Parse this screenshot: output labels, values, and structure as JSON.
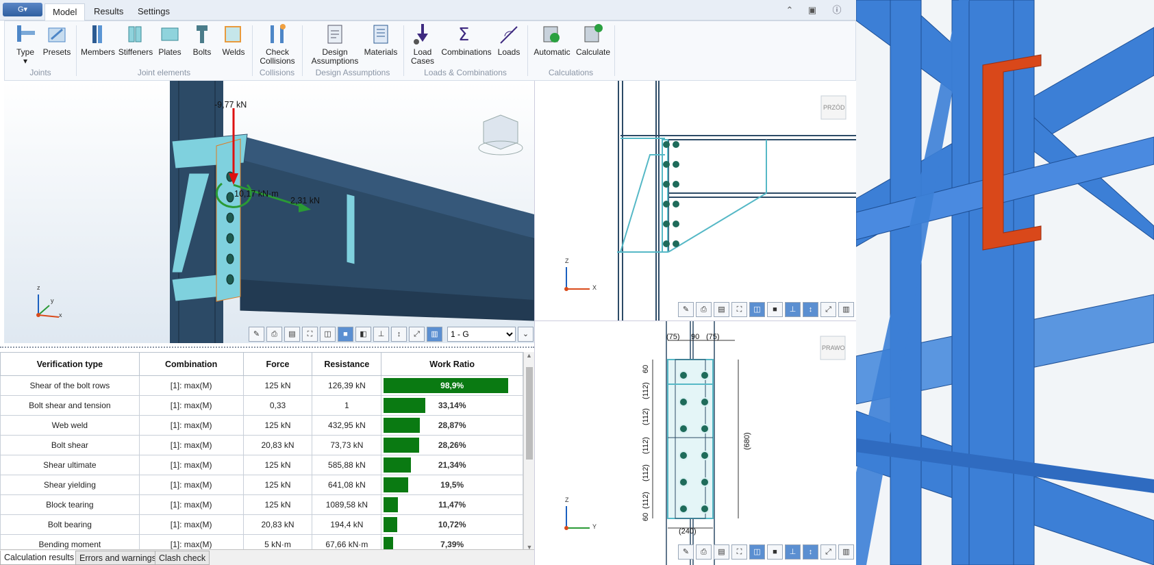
{
  "app_button": "G▾",
  "tabs": [
    {
      "label": "Model"
    },
    {
      "label": "Results"
    },
    {
      "label": "Settings"
    }
  ],
  "ribbon": {
    "buttons": {
      "type": "Type",
      "presets": "Presets",
      "members": "Members",
      "stiffeners": "Stiffeners",
      "plates": "Plates",
      "bolts": "Bolts",
      "welds": "Welds",
      "check1": "Check",
      "check2": "Collisions",
      "design1": "Design",
      "design2": "Assumptions",
      "materials": "Materials",
      "load1": "Load",
      "load2": "Cases",
      "combinations": "Combinations",
      "loads": "Loads",
      "automatic": "Automatic",
      "calculate": "Calculate"
    },
    "groups": {
      "joints": "Joints",
      "joint_elements": "Joint elements",
      "collisions": "Collisions",
      "design_assumptions": "Design Assumptions",
      "loads_combinations": "Loads & Combinations",
      "calculations": "Calculations"
    }
  },
  "view3d": {
    "load_vertical": "-9,77 kN",
    "moment": "10,17 kN·m",
    "load_axial": "2,31 kN",
    "axis_x": "x",
    "axis_y": "y",
    "axis_z": "z",
    "combo_selected": "1 - G"
  },
  "view_front": {
    "cube_label": "PRZÓD",
    "axis_x": "X",
    "axis_z": "Z"
  },
  "view_side": {
    "cube_label": "PRAWO",
    "axis_y": "Y",
    "axis_z": "Z",
    "dims": {
      "top_left": "(75)",
      "top_mid": "90",
      "top_right": "(75)",
      "bottom": "(240)",
      "right": "(680)",
      "v1": "60",
      "v2": "(112)",
      "v3": "(112)",
      "v4": "(112)",
      "v5": "(112)",
      "v6": "(112)",
      "v7": "60"
    }
  },
  "results_table": {
    "headers": [
      "Verification type",
      "Combination",
      "Force",
      "Resistance",
      "Work Ratio"
    ],
    "rows": [
      {
        "type": "Shear of the bolt rows",
        "combination": "[1]: max(M)",
        "force": "125 kN",
        "resistance": "126,39 kN",
        "ratio": "98,9%",
        "value": 98.9
      },
      {
        "type": "Bolt shear and tension",
        "combination": "[1]: max(M)",
        "force": "0,33",
        "resistance": "1",
        "ratio": "33,14%",
        "value": 33.14
      },
      {
        "type": "Web weld",
        "combination": "[1]: max(M)",
        "force": "125 kN",
        "resistance": "432,95 kN",
        "ratio": "28,87%",
        "value": 28.87
      },
      {
        "type": "Bolt shear",
        "combination": "[1]: max(M)",
        "force": "20,83 kN",
        "resistance": "73,73 kN",
        "ratio": "28,26%",
        "value": 28.26
      },
      {
        "type": "Shear ultimate",
        "combination": "[1]: max(M)",
        "force": "125 kN",
        "resistance": "585,88 kN",
        "ratio": "21,34%",
        "value": 21.34
      },
      {
        "type": "Shear yielding",
        "combination": "[1]: max(M)",
        "force": "125 kN",
        "resistance": "641,08 kN",
        "ratio": "19,5%",
        "value": 19.5
      },
      {
        "type": "Block tearing",
        "combination": "[1]: max(M)",
        "force": "125 kN",
        "resistance": "1089,58 kN",
        "ratio": "11,47%",
        "value": 11.47
      },
      {
        "type": "Bolt bearing",
        "combination": "[1]: max(M)",
        "force": "20,83 kN",
        "resistance": "194,4 kN",
        "ratio": "10,72%",
        "value": 10.72
      },
      {
        "type": "Bending moment",
        "combination": "[1]: max(M)",
        "force": "5 kN·m",
        "resistance": "67,66 kN·m",
        "ratio": "7,39%",
        "value": 7.39
      }
    ]
  },
  "bottom_tabs": [
    {
      "label": "Calculation results"
    },
    {
      "label": "Errors and warnings"
    },
    {
      "label": "Clash check"
    }
  ],
  "colors": {
    "bar": "#0a7a12",
    "steel": "#2c4a66",
    "plate": "#7fd1de",
    "model_blue": "#3c7fd6",
    "highlight": "#d9481a"
  }
}
